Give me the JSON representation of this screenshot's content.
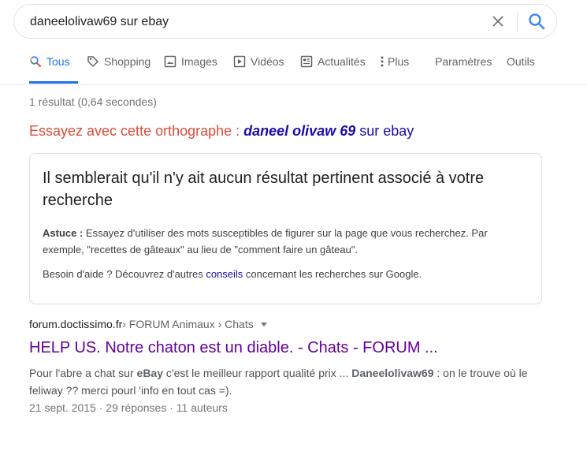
{
  "search": {
    "query": "daneelolivaw69 sur ebay"
  },
  "tabs": [
    {
      "label": "Tous",
      "icon": "search-icon",
      "active": true
    },
    {
      "label": "Shopping",
      "icon": "tag-icon"
    },
    {
      "label": "Images",
      "icon": "image-icon"
    },
    {
      "label": "Vidéos",
      "icon": "video-icon"
    },
    {
      "label": "Actualités",
      "icon": "news-icon"
    },
    {
      "label": "Plus",
      "icon": "more-vert-icon"
    },
    {
      "label": "Paramètres"
    },
    {
      "label": "Outils"
    }
  ],
  "stats": "1 résultat (0,64 secondes)",
  "spelling": {
    "prefix": "Essayez avec cette orthographe : ",
    "corrected": "daneel olivaw 69",
    "suffix": " sur ebay"
  },
  "no_result_card": {
    "title": "Il semblerait qu'il n'y ait aucun résultat pertinent associé à votre recherche",
    "tip_label": "Astuce :",
    "tip_text": " Essayez d'utiliser des mots susceptibles de figurer sur la page que vous recherchez. Par exemple, \"recettes de gâteaux\" au lieu de \"comment faire un gâteau\".",
    "help_prefix": "Besoin d'aide ? Découvrez d'autres ",
    "help_link": "conseils",
    "help_suffix": " concernant les recherches sur Google."
  },
  "result": {
    "site": "forum.doctissimo.fr",
    "breadcrumb": " › FORUM Animaux › Chats",
    "title": "HELP US. Notre chaton est un diable. - Chats - FORUM ...",
    "snippet_1": "Pour l'abre a chat sur ",
    "snippet_b1": "eBay",
    "snippet_2": " c'est le meilleur rapport qualité prix ... ",
    "snippet_b2": "Daneelolivaw69",
    "snippet_3": " : on le trouve où le feliway ?? merci pourl 'info en tout cas =).",
    "meta": "21 sept. 2015 · 29 réponses · 11 auteurs"
  },
  "colors": {
    "link_blue": "#1a0dab",
    "accent_blue": "#1a73e8",
    "visited_purple": "#660099",
    "spell_red": "#dd4b39"
  }
}
